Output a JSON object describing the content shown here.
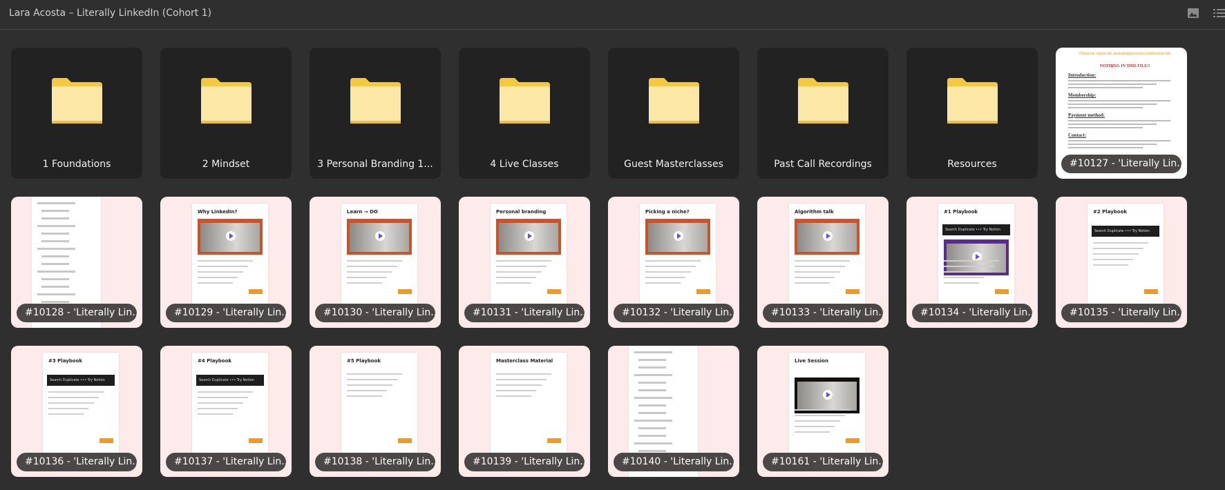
{
  "window": {
    "title": "Lara Acosta – Literally LinkedIn (Cohort 1)",
    "icons": [
      "image-view-icon",
      "list-view-icon"
    ]
  },
  "colors": {
    "folder": "#fbd96a",
    "thumb_bg": "#fdeaea",
    "pill": "#4b4746",
    "accent": "#f39a1e"
  },
  "folders": [
    {
      "label": "1 Foundations"
    },
    {
      "label": "2 Mindset"
    },
    {
      "label": "3 Personal Branding 1..."
    },
    {
      "label": "4 Live Classes"
    },
    {
      "label": "Guest Masterclasses"
    },
    {
      "label": "Past Call Recordings"
    },
    {
      "label": "Resources"
    }
  ],
  "document": {
    "label": "#10127 - 'Literally Lin...",
    "top_line": "Check our course list: www.ahappycourses.com/course-list/",
    "headline": "NOTHING IN THIS FILE!!",
    "sections": [
      "Introduction:",
      "Membership:",
      "Payment method:",
      "Contact:"
    ]
  },
  "files": [
    {
      "label": "#10128 - 'Literally Lin...",
      "title": "",
      "kind": "list"
    },
    {
      "label": "#10129 - 'Literally Lin...",
      "title": "Why LinkedIn?",
      "kind": "video"
    },
    {
      "label": "#10130 - 'Literally Lin...",
      "title": "Learn → DO",
      "kind": "video"
    },
    {
      "label": "#10131 - 'Literally Lin...",
      "title": "Personal branding",
      "kind": "video"
    },
    {
      "label": "#10132 - 'Literally Lin...",
      "title": "Picking a niche?",
      "kind": "video"
    },
    {
      "label": "#10133 - 'Literally Lin...",
      "title": "Algorithm talk",
      "kind": "video"
    },
    {
      "label": "#10134 - 'Literally Lin...",
      "title": "#1 Playbook",
      "kind": "embed-video"
    },
    {
      "label": "#10135 - 'Literally Lin...",
      "title": "#2 Playbook",
      "kind": "embed"
    },
    {
      "label": "#10136 - 'Literally Lin...",
      "title": "#3 Playbook",
      "kind": "embed"
    },
    {
      "label": "#10137 - 'Literally Lin...",
      "title": "#4 Playbook",
      "kind": "embed"
    },
    {
      "label": "#10138 - 'Literally Lin...",
      "title": "#5 Playbook",
      "kind": "text"
    },
    {
      "label": "#10139 - 'Literally Lin...",
      "title": "Masterclass Material",
      "kind": "text"
    },
    {
      "label": "#10140 - 'Literally Lin...",
      "title": "",
      "kind": "list"
    },
    {
      "label": "#10161 - 'Literally Lin...",
      "title": "Live Session",
      "kind": "video"
    }
  ],
  "embed_bar": "Search   Duplicate   •••   Try Notion"
}
